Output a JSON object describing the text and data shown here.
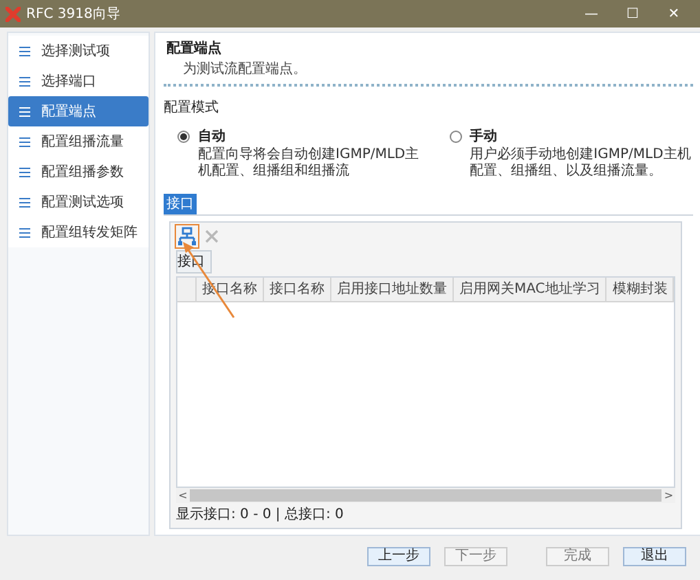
{
  "window": {
    "title": "RFC 3918向导",
    "controls": [
      "—",
      "☐",
      "✕"
    ]
  },
  "sidebar": {
    "items": [
      {
        "label": "选择测试项",
        "selected": false
      },
      {
        "label": "选择端口",
        "selected": false
      },
      {
        "label": "配置端点",
        "selected": true
      },
      {
        "label": "配置组播流量",
        "selected": false
      },
      {
        "label": "配置组播参数",
        "selected": false
      },
      {
        "label": "配置测试选项",
        "selected": false
      },
      {
        "label": "配置组转发矩阵",
        "selected": false
      }
    ]
  },
  "page": {
    "title": "配置端点",
    "subtitle": "为测试流配置端点。"
  },
  "mode": {
    "label": "配置模式",
    "options": [
      {
        "label": "自动",
        "description": "配置向导将会自动创建IGMP/MLD主机配置、组播组和组播流",
        "selected": true
      },
      {
        "label": "手动",
        "description": "用户必须手动地创建IGMP/MLD主机配置、组播组、以及组播流量。",
        "selected": false
      }
    ]
  },
  "tab": {
    "label": "接口",
    "selected": true
  },
  "grid": {
    "toolbar": [
      {
        "kind": "add",
        "disabled": false
      },
      {
        "kind": "delete",
        "disabled": true
      }
    ],
    "group_header": "接口",
    "columns": [
      "接口名称",
      "接口名称",
      "启用接口地址数量",
      "启用网关MAC地址学习",
      "模糊封装"
    ],
    "scroll_left": "<",
    "scroll_right": ">",
    "status": "显示接口: 0 - 0 | 总接口: 0"
  },
  "buttons": [
    {
      "label": "上一步",
      "disabled": false
    },
    {
      "label": "下一步",
      "disabled": true
    },
    {
      "label": "完成",
      "disabled": true
    },
    {
      "label": "退出",
      "disabled": false
    }
  ]
}
